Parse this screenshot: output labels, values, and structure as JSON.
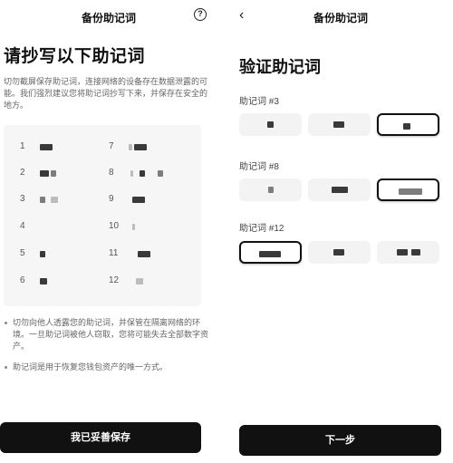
{
  "left_screen": {
    "header_title": "备份助记词",
    "help_icon_glyph": "?",
    "title": "请抄写以下助记词",
    "description": "切勿截屏保存助记词，连接网络的设备存在数据泄露的可能。我们强烈建议您将助记词抄写下来，并保存在安全的地方。",
    "words": [
      {
        "num": "1"
      },
      {
        "num": "2"
      },
      {
        "num": "3"
      },
      {
        "num": "4"
      },
      {
        "num": "5"
      },
      {
        "num": "6"
      },
      {
        "num": "7"
      },
      {
        "num": "8"
      },
      {
        "num": "9"
      },
      {
        "num": "10"
      },
      {
        "num": "11"
      },
      {
        "num": "12"
      }
    ],
    "bullets": [
      "切勿向他人透露您的助记词，并保管在隔离网络的环境。一旦助记词被他人窃取，您将可能失去全部数字资产。",
      "助记词是用于恢复您钱包资产的唯一方式。"
    ],
    "button_label": "我已妥善保存"
  },
  "right_screen": {
    "back_icon_glyph": "‹",
    "header_title": "备份助记词",
    "title": "验证助记词",
    "questions": [
      {
        "label": "助记词 #3",
        "selected_option": 3
      },
      {
        "label": "助记词 #8",
        "selected_option": 3
      },
      {
        "label": "助记词 #12",
        "selected_option": 1
      }
    ],
    "button_label": "下一步"
  },
  "colors": {
    "primary_button": "#111111",
    "panel_background": "#f6f6f7",
    "option_background": "#f3f3f4"
  }
}
